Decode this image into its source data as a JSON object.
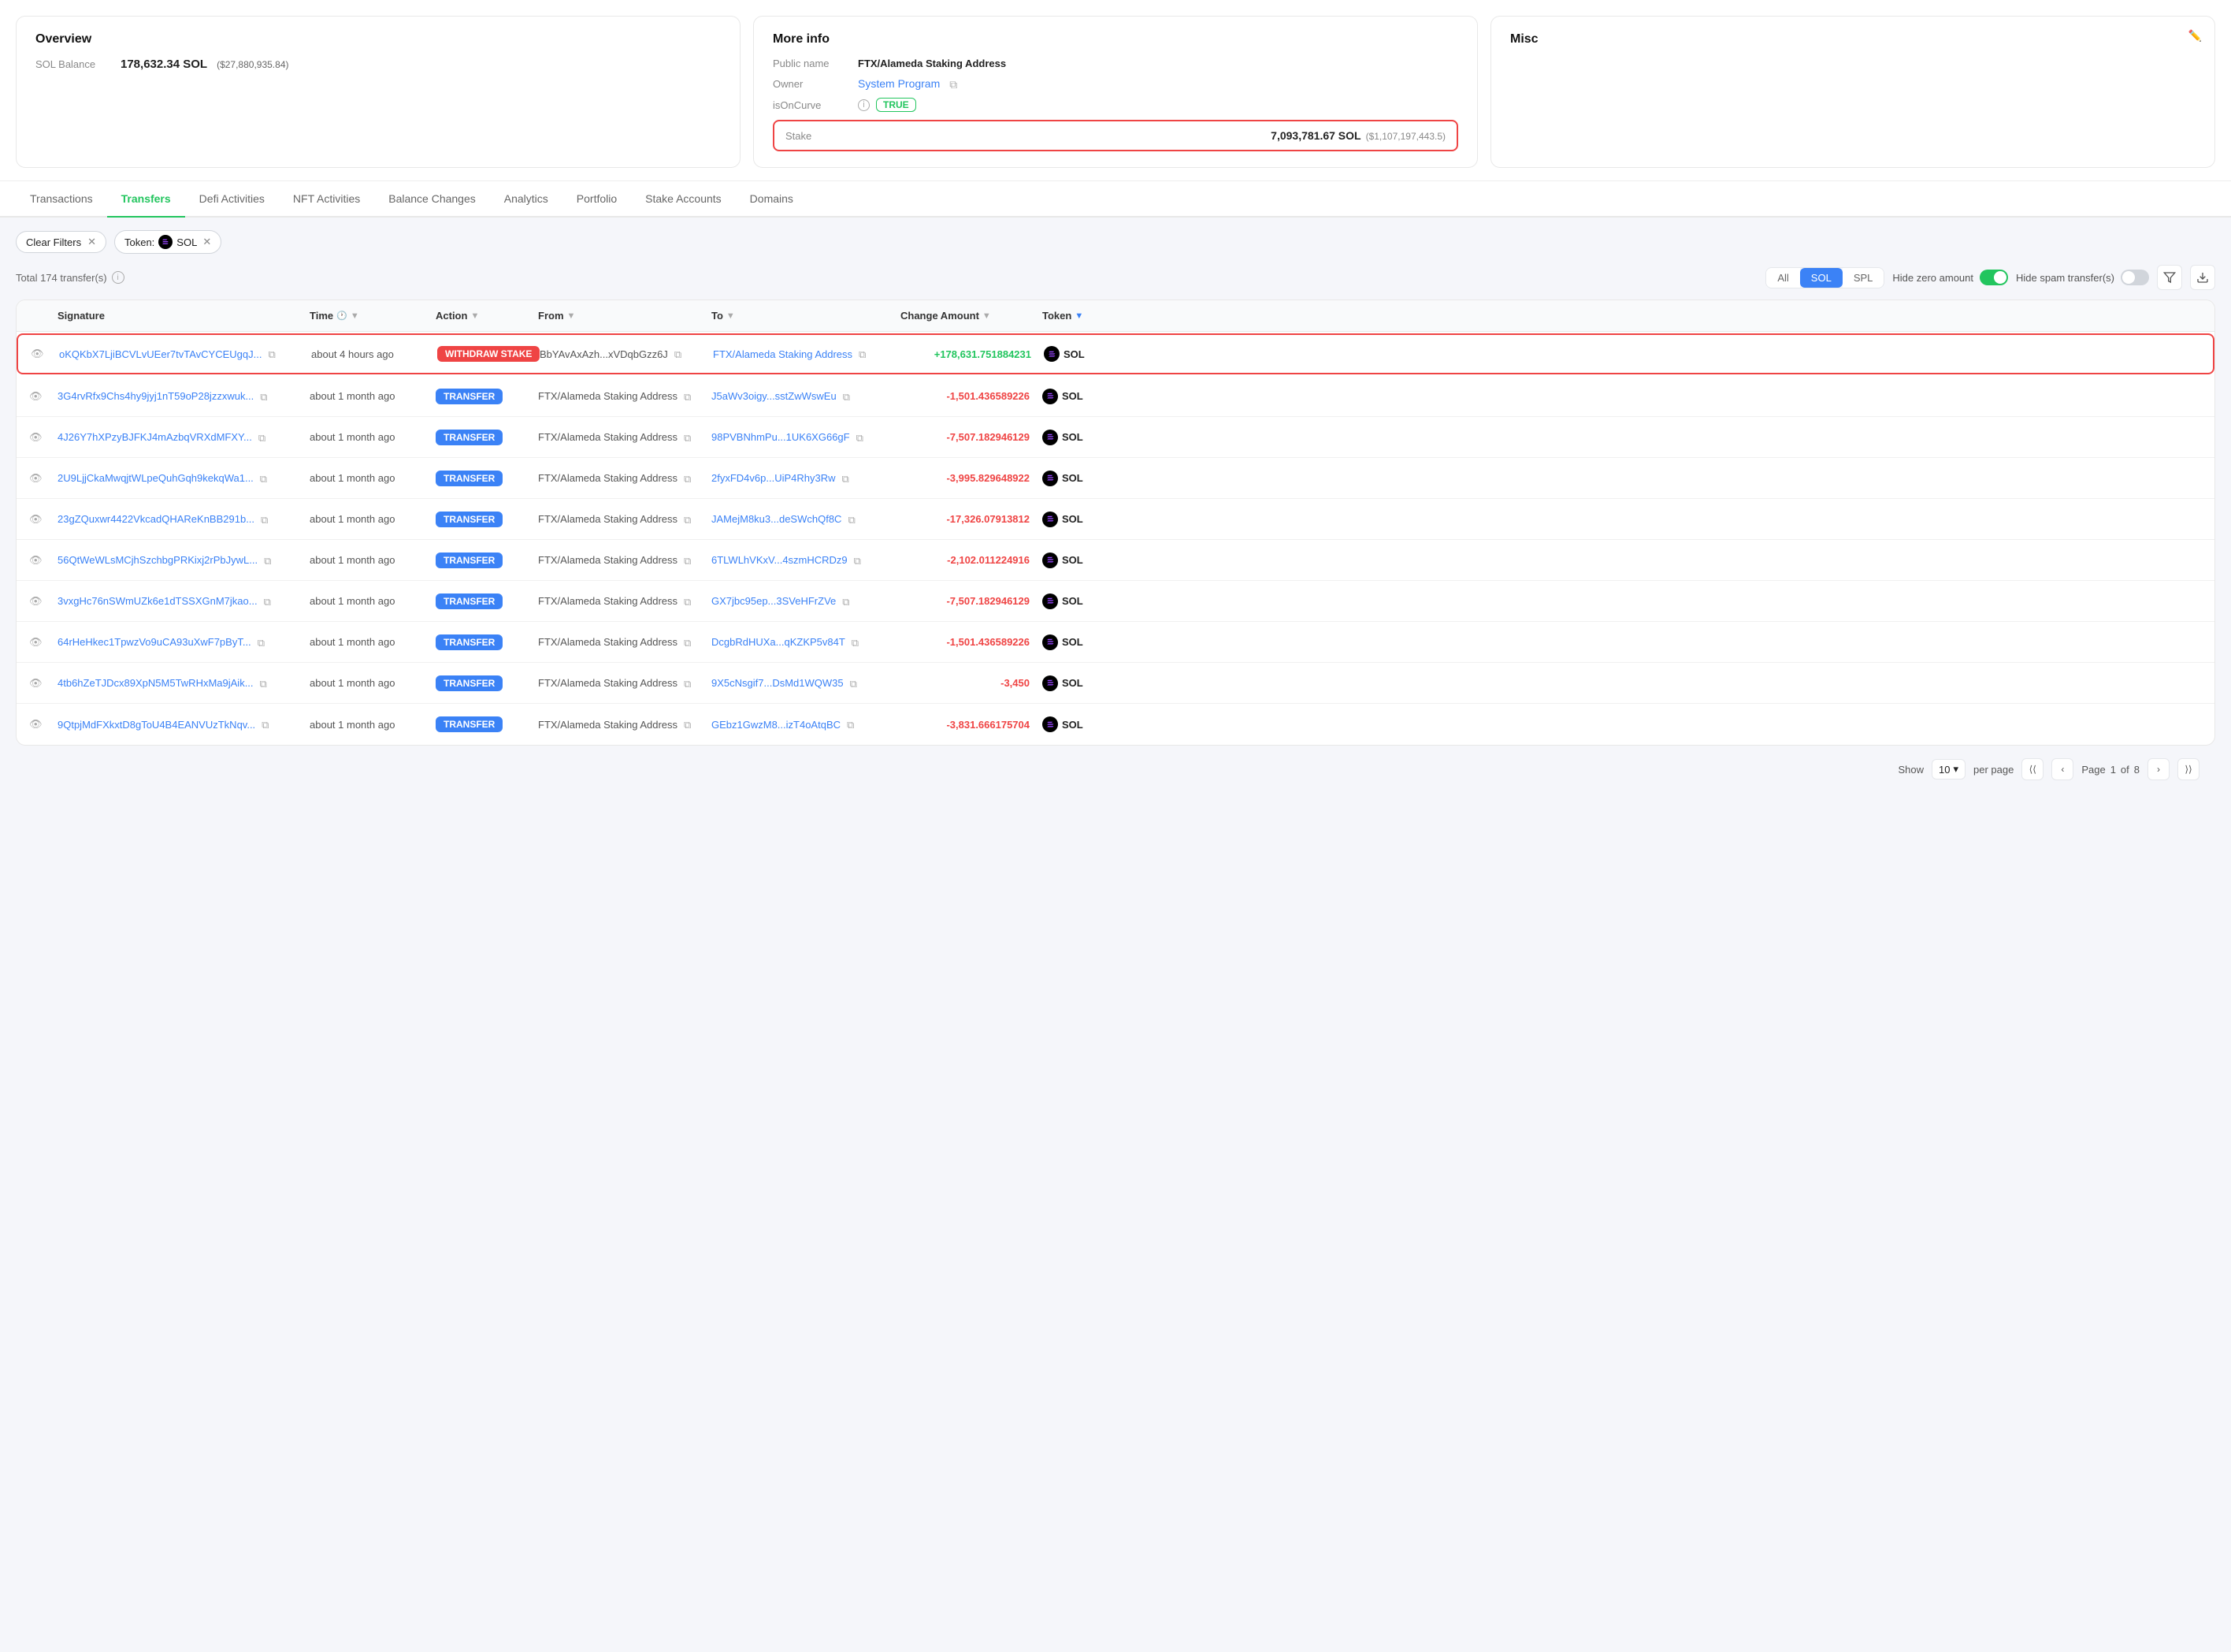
{
  "overview": {
    "title": "Overview",
    "sol_balance_label": "SOL Balance",
    "sol_balance_value": "178,632.34 SOL",
    "sol_balance_usd": "($27,880,935.84)"
  },
  "more_info": {
    "title": "More info",
    "public_name_label": "Public name",
    "public_name_value": "FTX/Alameda Staking Address",
    "owner_label": "Owner",
    "owner_value": "System Program",
    "is_on_curve_label": "isOnCurve",
    "is_on_curve_value": "TRUE",
    "stake_label": "Stake",
    "stake_value": "7,093,781.67 SOL",
    "stake_usd": "($1,107,197,443.5)"
  },
  "misc": {
    "title": "Misc"
  },
  "tabs": [
    {
      "label": "Transactions",
      "active": false
    },
    {
      "label": "Transfers",
      "active": true
    },
    {
      "label": "Defi Activities",
      "active": false
    },
    {
      "label": "NFT Activities",
      "active": false
    },
    {
      "label": "Balance Changes",
      "active": false
    },
    {
      "label": "Analytics",
      "active": false
    },
    {
      "label": "Portfolio",
      "active": false
    },
    {
      "label": "Stake Accounts",
      "active": false
    },
    {
      "label": "Domains",
      "active": false
    }
  ],
  "filters": {
    "clear_label": "Clear Filters",
    "token_label": "Token:",
    "token_value": "SOL"
  },
  "table_meta": {
    "total": "Total 174 transfer(s)",
    "type_all": "All",
    "type_sol": "SOL",
    "type_spl": "SPL",
    "hide_zero_label": "Hide zero amount",
    "hide_spam_label": "Hide spam transfer(s)"
  },
  "columns": {
    "signature": "Signature",
    "time": "Time",
    "action": "Action",
    "from": "From",
    "to": "To",
    "change_amount": "Change Amount",
    "token": "Token"
  },
  "rows": [
    {
      "highlighted": true,
      "signature": "oKQKbX7LjiBCVLvUEer7tvTAvCYCEUgqJ...",
      "time": "about 4 hours ago",
      "action": "WITHDRAW STAKE",
      "action_type": "withdraw",
      "from": "BbYAvAxAzh...xVDqbGzz6J",
      "to": "FTX/Alameda Staking Address",
      "change_amount": "+178,631.751884231",
      "amount_type": "pos",
      "token": "SOL"
    },
    {
      "highlighted": false,
      "signature": "3G4rvRfx9Chs4hy9jyj1nT59oP28jzzxwuk...",
      "time": "about 1 month ago",
      "action": "TRANSFER",
      "action_type": "transfer",
      "from": "FTX/Alameda Staking Address",
      "to": "J5aWv3oigy...sstZwWswEu",
      "change_amount": "-1,501.436589226",
      "amount_type": "neg",
      "token": "SOL"
    },
    {
      "highlighted": false,
      "signature": "4J26Y7hXPzyBJFKJ4mAzbqVRXdMFXY...",
      "time": "about 1 month ago",
      "action": "TRANSFER",
      "action_type": "transfer",
      "from": "FTX/Alameda Staking Address",
      "to": "98PVBNhmPu...1UK6XG66gF",
      "change_amount": "-7,507.182946129",
      "amount_type": "neg",
      "token": "SOL"
    },
    {
      "highlighted": false,
      "signature": "2U9LjjCkaMwqjtWLpeQuhGqh9kekqWa1...",
      "time": "about 1 month ago",
      "action": "TRANSFER",
      "action_type": "transfer",
      "from": "FTX/Alameda Staking Address",
      "to": "2fyxFD4v6p...UiP4Rhy3Rw",
      "change_amount": "-3,995.829648922",
      "amount_type": "neg",
      "token": "SOL"
    },
    {
      "highlighted": false,
      "signature": "23gZQuxwr4422VkcadQHAReKnBB291b...",
      "time": "about 1 month ago",
      "action": "TRANSFER",
      "action_type": "transfer",
      "from": "FTX/Alameda Staking Address",
      "to": "JAMejM8ku3...deSWchQf8C",
      "change_amount": "-17,326.07913812",
      "amount_type": "neg",
      "token": "SOL"
    },
    {
      "highlighted": false,
      "signature": "56QtWeWLsMCjhSzchbgPRKixj2rPbJywL...",
      "time": "about 1 month ago",
      "action": "TRANSFER",
      "action_type": "transfer",
      "from": "FTX/Alameda Staking Address",
      "to": "6TLWLhVKxV...4szmHCRDz9",
      "change_amount": "-2,102.011224916",
      "amount_type": "neg",
      "token": "SOL"
    },
    {
      "highlighted": false,
      "signature": "3vxgHc76nSWmUZk6e1dTSSXGnM7jkao...",
      "time": "about 1 month ago",
      "action": "TRANSFER",
      "action_type": "transfer",
      "from": "FTX/Alameda Staking Address",
      "to": "GX7jbc95ep...3SVeHFrZVe",
      "change_amount": "-7,507.182946129",
      "amount_type": "neg",
      "token": "SOL"
    },
    {
      "highlighted": false,
      "signature": "64rHeHkec1TpwzVo9uCA93uXwF7pByT...",
      "time": "about 1 month ago",
      "action": "TRANSFER",
      "action_type": "transfer",
      "from": "FTX/Alameda Staking Address",
      "to": "DcgbRdHUXa...qKZKP5v84T",
      "change_amount": "-1,501.436589226",
      "amount_type": "neg",
      "token": "SOL"
    },
    {
      "highlighted": false,
      "signature": "4tb6hZeTJDcx89XpN5M5TwRHxMa9jAik...",
      "time": "about 1 month ago",
      "action": "TRANSFER",
      "action_type": "transfer",
      "from": "FTX/Alameda Staking Address",
      "to": "9X5cNsgif7...DsMd1WQW35",
      "change_amount": "-3,450",
      "amount_type": "neg",
      "token": "SOL"
    },
    {
      "highlighted": false,
      "signature": "9QtpjMdFXkxtD8gToU4B4EANVUzTkNqv...",
      "time": "about 1 month ago",
      "action": "TRANSFER",
      "action_type": "transfer",
      "from": "FTX/Alameda Staking Address",
      "to": "GEbz1GwzM8...izT4oAtqBC",
      "change_amount": "-3,831.666175704",
      "amount_type": "neg",
      "token": "SOL"
    }
  ],
  "pagination": {
    "show_label": "Show",
    "per_page": "10",
    "per_page_unit": "per page",
    "page_label": "Page",
    "current_page": "1",
    "total_pages": "8"
  }
}
